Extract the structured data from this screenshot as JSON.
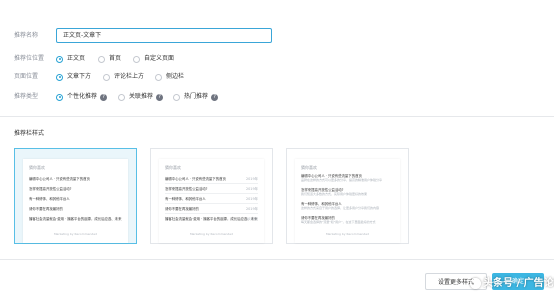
{
  "form": {
    "name_label": "推荐名称",
    "name_value": "正文页-文章下",
    "page_label": "推荐位位置",
    "page_options": [
      "正文页",
      "首页",
      "自定义页面"
    ],
    "pos_label": "页面位置",
    "pos_options": [
      "文章下方",
      "评论栏上方",
      "侧边栏"
    ],
    "type_label": "推荐类型",
    "type_options": [
      "个性化推荐",
      "关联推荐",
      "热门推荐"
    ],
    "help_icon": "?"
  },
  "section": {
    "title": "推荐栏样式"
  },
  "cards": [
    {
      "title": "猜你喜欢",
      "lines": [
        "编辑中心公司人 · 只说有些流量下的首页",
        "怎样来提高开放性公益活动?",
        "有一种修饰、和其他平台人",
        "请你不要在再找最好的",
        "播客社会流量就会·费用 · 播客平台的起源，成长后应选、未来"
      ],
      "footer": "Marketing by Recommended"
    },
    {
      "title": "猜你喜欢",
      "lines": [
        {
          "text": "编辑中心公司人 · 只说有些流量下的首页",
          "time": "2019年"
        },
        {
          "text": "怎样来提高开放性公益活动?",
          "time": "2019年"
        },
        {
          "text": "有一种修饰、和其他平台人",
          "time": "2019年"
        },
        {
          "text": "请你不要在再找最好的",
          "time": "2019年"
        },
        {
          "text": "播客社会流量就会·费用 · 播客平台的起源，成长后应选、未来",
          "time": "2019年"
        }
      ],
      "footer": "Marketing by Recommended"
    },
    {
      "title": "猜你喜欢",
      "items": [
        {
          "head": "编辑中心公司人 · 只说有些流量下的首页",
          "sub": "品牌在这样的方式可以更多的分享，提高的精准用户体验分享"
        },
        {
          "head": "怎样来提高开放性公益活动?",
          "sub": "我们知道大多数的方式，实际用户体验更好的效果"
        },
        {
          "head": "有一种修饰、和其他平台人",
          "sub": "这样的方式来自于用户的选择，让更多用户分享我们的内容"
        },
        {
          "head": "请你不要在再找最好的",
          "sub": "每天都会选择的\"流量\"和\"用户\"，在这下里面最好的方式"
        }
      ],
      "footer": "Marketing by Recommended"
    }
  ],
  "actions": {
    "more_label": "设置更多样式",
    "ok_label": "确定"
  },
  "watermark": "头条号 / 广告论坛",
  "colors": {
    "accent": "#3cb6e2",
    "selected_border": "#58bfe6"
  }
}
